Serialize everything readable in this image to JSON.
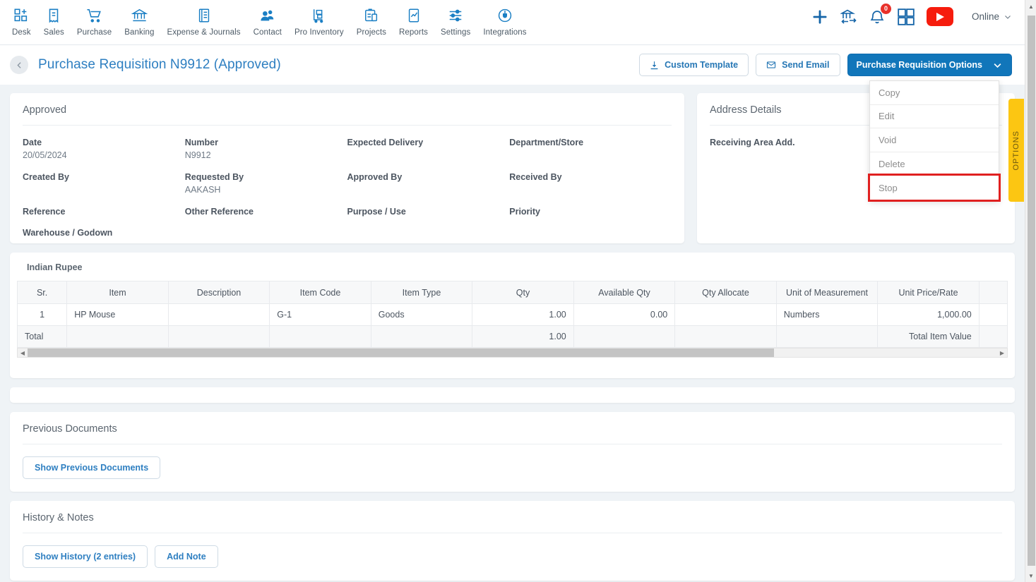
{
  "topnav": {
    "items": [
      {
        "label": "Desk",
        "icon": "dashboard-grid-icon"
      },
      {
        "label": "Sales",
        "icon": "receipt-icon"
      },
      {
        "label": "Purchase",
        "icon": "shopping-cart-icon"
      },
      {
        "label": "Banking",
        "icon": "bank-icon"
      },
      {
        "label": "Expense & Journals",
        "icon": "ledger-book-icon"
      },
      {
        "label": "Contact",
        "icon": "people-icon"
      },
      {
        "label": "Pro Inventory",
        "icon": "hand-truck-icon"
      },
      {
        "label": "Projects",
        "icon": "clipboard-icon"
      },
      {
        "label": "Reports",
        "icon": "report-chart-icon"
      },
      {
        "label": "Settings",
        "icon": "sliders-icon"
      },
      {
        "label": "Integrations",
        "icon": "plug-circle-icon"
      }
    ],
    "right": {
      "add_icon": "plus-icon",
      "bank_transfer_icon": "bank-transfer-icon",
      "notification_icon": "bell-icon",
      "notification_count": "0",
      "apps_icon": "apps-grid-icon",
      "video_icon": "youtube-icon",
      "status_label": "Online",
      "status_caret_icon": "chevron-down-icon"
    }
  },
  "header": {
    "back_icon": "chevron-left-icon",
    "title": "Purchase Requisition N9912 (Approved)",
    "custom_template_label": "Custom Template",
    "custom_template_icon": "download-icon",
    "send_email_label": "Send Email",
    "send_email_icon": "envelope-icon",
    "options_label": "Purchase Requisition Options",
    "options_caret_icon": "chevron-down-icon"
  },
  "dropdown": {
    "items": [
      {
        "label": "Copy",
        "highlighted": false
      },
      {
        "label": "Edit",
        "highlighted": false
      },
      {
        "label": "Void",
        "highlighted": false
      },
      {
        "label": "Delete",
        "highlighted": false
      },
      {
        "label": "Stop",
        "highlighted": true
      }
    ],
    "highlight_color": "#e02020"
  },
  "approved_card": {
    "title": "Approved",
    "fields": [
      {
        "label": "Date",
        "value": "20/05/2024"
      },
      {
        "label": "Number",
        "value": "N9912"
      },
      {
        "label": "Expected Delivery",
        "value": ""
      },
      {
        "label": "Department/Store",
        "value": ""
      },
      {
        "label": "Created By",
        "value": ""
      },
      {
        "label": "Requested By",
        "value": "AAKASH"
      },
      {
        "label": "Approved By",
        "value": ""
      },
      {
        "label": "Received By",
        "value": ""
      },
      {
        "label": "Reference",
        "value": ""
      },
      {
        "label": "Other Reference",
        "value": ""
      },
      {
        "label": "Purpose / Use",
        "value": ""
      },
      {
        "label": "Priority",
        "value": ""
      },
      {
        "label": "Warehouse / Godown",
        "value": ""
      }
    ]
  },
  "address_card": {
    "title": "Address Details",
    "fields": [
      {
        "label": "Receiving Area Add.",
        "value": ""
      }
    ]
  },
  "items_table": {
    "currency_label": "Indian Rupee",
    "columns": [
      "Sr.",
      "Item",
      "Description",
      "Item Code",
      "Item Type",
      "Qty",
      "Available Qty",
      "Qty Allocate",
      "Unit of Measurement",
      "Unit Price/Rate",
      ""
    ],
    "rows": [
      {
        "sr": "1",
        "item": "HP Mouse",
        "description": "",
        "item_code": "G-1",
        "item_type": "Goods",
        "qty": "1.00",
        "available_qty": "0.00",
        "qty_allocate": "",
        "uom": "Numbers",
        "unit_price": "1,000.00",
        "extra": ""
      }
    ],
    "total_row": {
      "label": "Total",
      "qty": "1.00",
      "total_item_value_label": "Total Item Value"
    }
  },
  "previous_documents": {
    "title": "Previous Documents",
    "show_button_label": "Show Previous Documents"
  },
  "history_notes": {
    "title": "History & Notes",
    "show_history_label": "Show History (2 entries)",
    "add_note_label": "Add Note"
  },
  "options_tab": {
    "label": "OPTIONS",
    "color": "#fcc612"
  },
  "colors": {
    "primary_blue": "#1176ba",
    "link_blue": "#2e7fc1",
    "page_bg": "#eff3f6",
    "highlight_red": "#e02020"
  }
}
